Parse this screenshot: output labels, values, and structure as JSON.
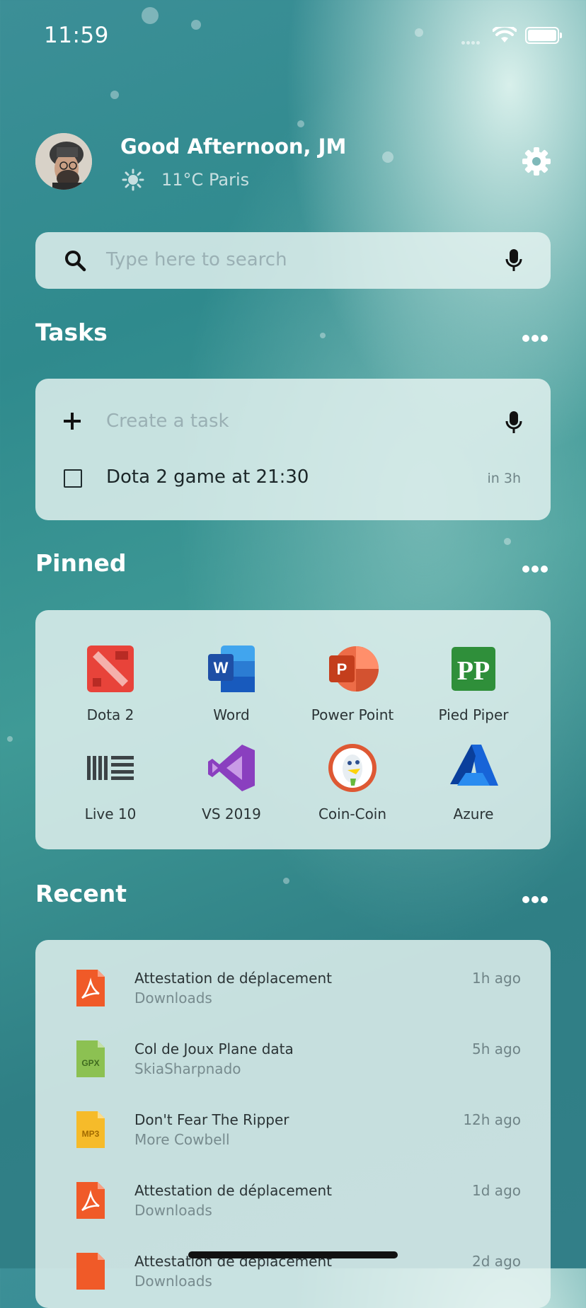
{
  "status": {
    "time": "11:59"
  },
  "header": {
    "greeting": "Good Afternoon, JM",
    "temperature": "11°C",
    "city": "Paris",
    "icons": [
      "sun-icon",
      "gear-icon"
    ]
  },
  "search": {
    "placeholder": "Type here to search"
  },
  "tasks": {
    "title": "Tasks",
    "create_placeholder": "Create a task",
    "items": [
      {
        "label": "Dota 2 game at 21:30",
        "due": "in 3h"
      }
    ]
  },
  "pinned": {
    "title": "Pinned",
    "apps": [
      {
        "label": "Dota 2",
        "icon": "dota-icon",
        "color": "#e8433a"
      },
      {
        "label": "Word",
        "icon": "word-icon",
        "color": "#2b5eb8"
      },
      {
        "label": "Power Point",
        "icon": "powerpoint-icon",
        "color": "#d04a2b"
      },
      {
        "label": "Pied Piper",
        "icon": "pied-piper-icon",
        "color": "#2f8f3a"
      },
      {
        "label": "Live 10",
        "icon": "ableton-live-icon",
        "color": "#3c4346"
      },
      {
        "label": "VS 2019",
        "icon": "visual-studio-icon",
        "color": "#8a3fbf"
      },
      {
        "label": "Coin-Coin",
        "icon": "duckduckgo-icon",
        "color": "#de5833"
      },
      {
        "label": "Azure",
        "icon": "azure-icon",
        "color": "#1764d8"
      }
    ]
  },
  "recent": {
    "title": "Recent",
    "items": [
      {
        "title": "Attestation de déplacement",
        "location": "Downloads",
        "ago": "1h ago",
        "type": "pdf",
        "color": "#f05a28"
      },
      {
        "title": "Col de Joux Plane data",
        "location": "SkiaSharpnado",
        "ago": "5h ago",
        "type": "GPX",
        "color": "#8cc152"
      },
      {
        "title": "Don't Fear The Ripper",
        "location": "More Cowbell",
        "ago": "12h ago",
        "type": "MP3",
        "color": "#f6bb2a"
      },
      {
        "title": "Attestation de déplacement",
        "location": "Downloads",
        "ago": "1d ago",
        "type": "pdf",
        "color": "#f05a28"
      },
      {
        "title": "Attestation de déplacement",
        "location": "Downloads",
        "ago": "2d ago",
        "type": "pdf",
        "color": "#f05a28"
      }
    ]
  }
}
